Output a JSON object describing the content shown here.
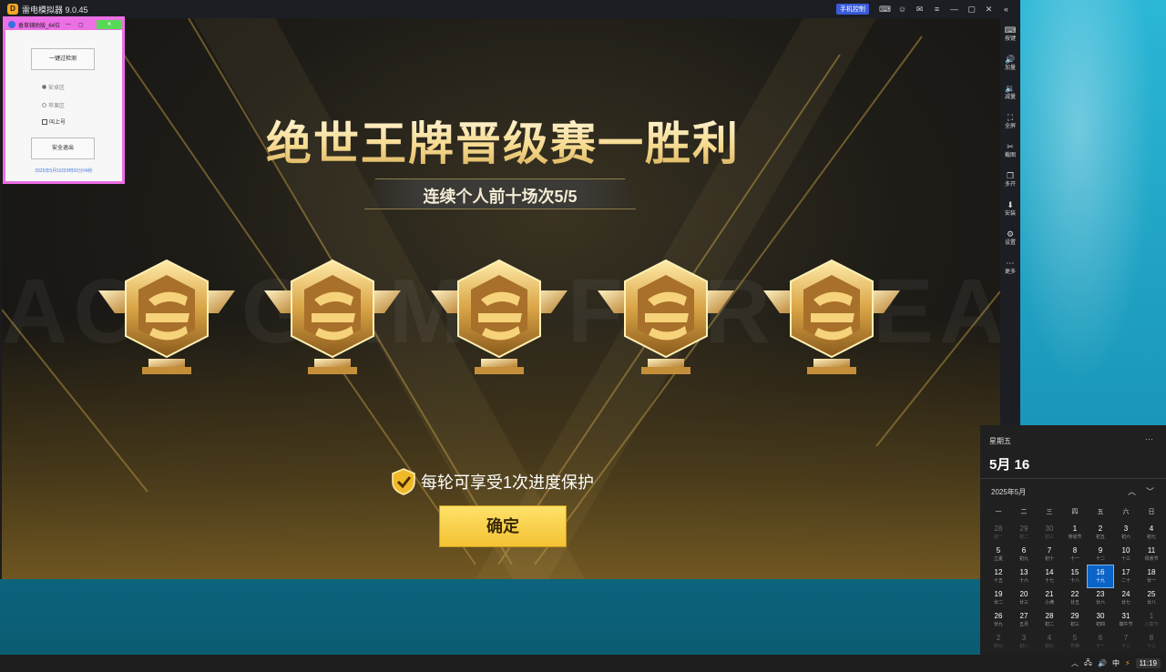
{
  "emulator": {
    "title": "雷电模拟器 9.0.45",
    "logo_glyph": "D",
    "remote_badge": "手机控制",
    "titlebar_buttons": [
      "keyboard-icon",
      "user-icon",
      "mail-icon",
      "menu-icon",
      "minimize-icon",
      "maximize-icon",
      "close-icon",
      "collapse-icon"
    ],
    "sidebar": [
      {
        "icon": "⌨",
        "label": "按键"
      },
      {
        "icon": "🔊",
        "label": "加量"
      },
      {
        "icon": "🔉",
        "label": "减量"
      },
      {
        "icon": "⛶",
        "label": "全屏"
      },
      {
        "icon": "✂",
        "label": "截图"
      },
      {
        "icon": "❐",
        "label": "多开"
      },
      {
        "icon": "⬇",
        "label": "安装"
      },
      {
        "icon": "⚙",
        "label": "设置"
      },
      {
        "icon": "⋯",
        "label": "更多"
      }
    ]
  },
  "game": {
    "title": "绝世王牌晋级赛一胜利",
    "subtitle": "连续个人前十场次5/5",
    "medal_count": 5,
    "protect_text": "每轮可享受1次进度保护",
    "confirm_label": "确定"
  },
  "tool": {
    "title": "香草辅助版_64位",
    "button_detect": "一键过检测",
    "radio_1": "安卓区",
    "radio_2": "苹果区",
    "checkbox": "叫上号",
    "button_exit": "安全退出",
    "footer": "2025年5月16日9时00分04秒"
  },
  "calendar": {
    "weekday": "星期五",
    "date": "5月 16",
    "month": "2025年5月",
    "headers": [
      "一",
      "二",
      "三",
      "四",
      "五",
      "六",
      "日"
    ],
    "rows": [
      [
        {
          "d": "28",
          "l": "初一",
          "dim": true
        },
        {
          "d": "29",
          "l": "初二",
          "dim": true
        },
        {
          "d": "30",
          "l": "初三",
          "dim": true
        },
        {
          "d": "1",
          "l": "劳动节"
        },
        {
          "d": "2",
          "l": "初五"
        },
        {
          "d": "3",
          "l": "初六"
        },
        {
          "d": "4",
          "l": "初七"
        }
      ],
      [
        {
          "d": "5",
          "l": "立夏"
        },
        {
          "d": "6",
          "l": "初九"
        },
        {
          "d": "7",
          "l": "初十"
        },
        {
          "d": "8",
          "l": "十一"
        },
        {
          "d": "9",
          "l": "十二"
        },
        {
          "d": "10",
          "l": "十三"
        },
        {
          "d": "11",
          "l": "母亲节"
        }
      ],
      [
        {
          "d": "12",
          "l": "十五"
        },
        {
          "d": "13",
          "l": "十六"
        },
        {
          "d": "14",
          "l": "十七"
        },
        {
          "d": "15",
          "l": "十八"
        },
        {
          "d": "16",
          "l": "十九",
          "today": true
        },
        {
          "d": "17",
          "l": "二十"
        },
        {
          "d": "18",
          "l": "廿一"
        }
      ],
      [
        {
          "d": "19",
          "l": "廿二"
        },
        {
          "d": "20",
          "l": "廿三"
        },
        {
          "d": "21",
          "l": "小满"
        },
        {
          "d": "22",
          "l": "廿五"
        },
        {
          "d": "23",
          "l": "廿六"
        },
        {
          "d": "24",
          "l": "廿七"
        },
        {
          "d": "25",
          "l": "廿八"
        }
      ],
      [
        {
          "d": "26",
          "l": "廿九"
        },
        {
          "d": "27",
          "l": "五月"
        },
        {
          "d": "28",
          "l": "初二"
        },
        {
          "d": "29",
          "l": "初三"
        },
        {
          "d": "30",
          "l": "初四"
        },
        {
          "d": "31",
          "l": "端午节"
        },
        {
          "d": "1",
          "l": "儿童节",
          "dim": true
        }
      ],
      [
        {
          "d": "2",
          "l": "初七",
          "dim": true
        },
        {
          "d": "3",
          "l": "初八",
          "dim": true
        },
        {
          "d": "4",
          "l": "初九",
          "dim": true
        },
        {
          "d": "5",
          "l": "芒种",
          "dim": true
        },
        {
          "d": "6",
          "l": "十一",
          "dim": true
        },
        {
          "d": "7",
          "l": "十二",
          "dim": true
        },
        {
          "d": "8",
          "l": "十三",
          "dim": true
        }
      ]
    ]
  },
  "taskbar": {
    "ime": "中",
    "clock": "11:19"
  },
  "colors": {
    "gold": "#f4c233",
    "tool_border": "#ec6fe6",
    "today": "#0a64c8"
  }
}
